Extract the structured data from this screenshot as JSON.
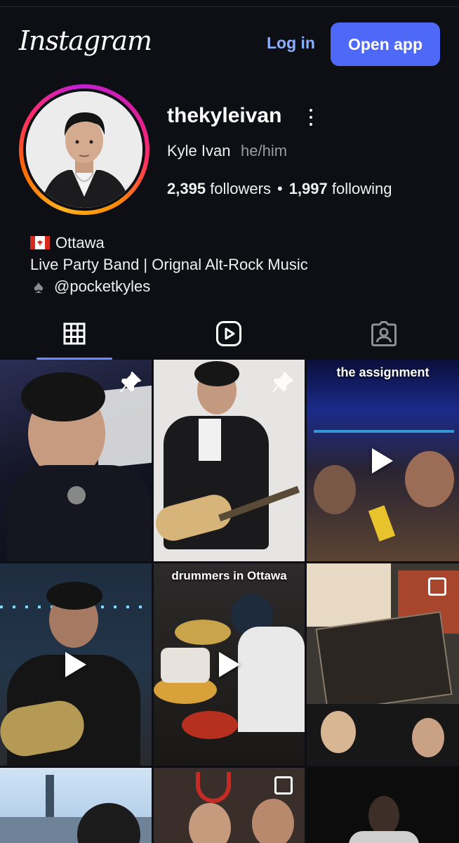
{
  "header": {
    "logo_text": "Instagram",
    "login_label": "Log in",
    "open_app_label": "Open app"
  },
  "profile": {
    "username": "thekyleivan",
    "full_name": "Kyle Ivan",
    "pronouns": "he/him",
    "followers_count": "2,395",
    "followers_label": "followers",
    "separator": "•",
    "following_count": "1,997",
    "following_label": "following",
    "bio": {
      "location": "Ottawa",
      "description": "Live Party Band | Orignal Alt-Rock Music",
      "linked_account": "@pocketkyles"
    }
  },
  "tabs": [
    {
      "name": "posts",
      "icon": "grid-icon",
      "active": true
    },
    {
      "name": "reels",
      "icon": "reels-icon",
      "active": false
    },
    {
      "name": "tagged",
      "icon": "tagged-icon",
      "active": false
    }
  ],
  "grid": {
    "posts": [
      {
        "type": "pinned"
      },
      {
        "type": "pinned"
      },
      {
        "type": "reel",
        "caption": "the assignment"
      },
      {
        "type": "reel"
      },
      {
        "type": "reel",
        "caption": "drummers in Ottawa"
      },
      {
        "type": "carousel"
      },
      {
        "type": "image"
      },
      {
        "type": "carousel"
      },
      {
        "type": "image"
      }
    ]
  },
  "colors": {
    "background": "#0e0f14",
    "accent_button": "#4e68f7",
    "login_link": "#8ab0ff",
    "active_tab_indicator": "#6b8cff",
    "secondary_text": "#9a9ba3"
  }
}
